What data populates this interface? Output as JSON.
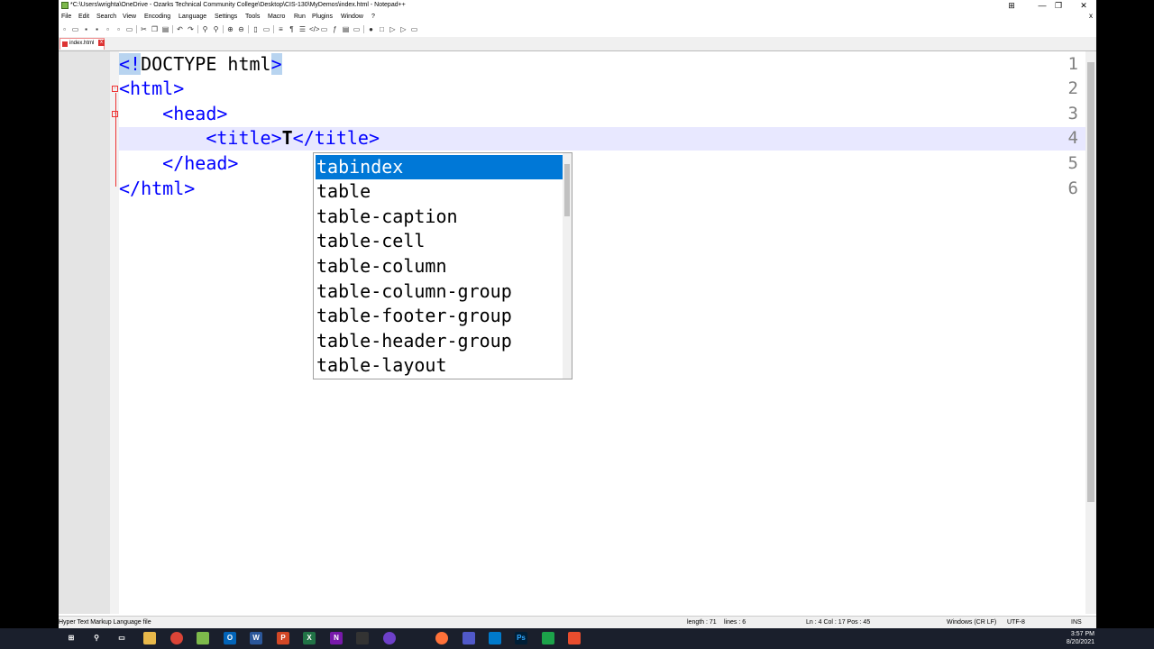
{
  "window": {
    "title": "*C:\\Users\\wrighta\\OneDrive - Ozarks Technical Community College\\Desktop\\CIS-130\\MyDemos\\index.html - Notepad++",
    "controls": {
      "tile": "⊞",
      "minimize": "—",
      "restore": "❐",
      "close": "✕"
    },
    "close_x2": "x"
  },
  "menu": [
    "File",
    "Edit",
    "Search",
    "View",
    "Encoding",
    "Language",
    "Settings",
    "Tools",
    "Macro",
    "Run",
    "Plugins",
    "Window",
    "?"
  ],
  "tab": {
    "label": "index.html",
    "close": "x"
  },
  "editor": {
    "line_numbers": [
      "1",
      "2",
      "3",
      "4",
      "5",
      "6"
    ],
    "lines": {
      "l1_open": "<!",
      "l1_doctype": "DOCTYPE html",
      "l1_close": ">",
      "l2": "<html>",
      "l3": "    <head>",
      "l4_indent": "        ",
      "l4_open": "<title>",
      "l4_typed": "T",
      "l4_close": "</title>",
      "l5": "    </head>",
      "l6": "</html>"
    }
  },
  "autocomplete": {
    "items": [
      "tabindex",
      "table",
      "table-caption",
      "table-cell",
      "table-column",
      "table-column-group",
      "table-footer-group",
      "table-header-group",
      "table-layout"
    ],
    "selected_index": 0
  },
  "status": {
    "file_type": "Hyper Text Markup Language file",
    "length": "length : 71",
    "lines": "lines : 6",
    "position": "Ln : 4    Col : 17    Pos : 45",
    "eol": "Windows (CR LF)",
    "encoding": "UTF-8",
    "mode": "INS"
  },
  "taskbar": {
    "time": "3:57 PM",
    "date": "8/20/2021",
    "apps": [
      "start-icon",
      "search-icon",
      "task-view-icon",
      "file-explorer-icon",
      "chrome-icon",
      "notepadpp-icon",
      "outlook-icon",
      "word-icon",
      "powerpoint-icon",
      "excel-icon",
      "onenote-icon",
      "github-icon",
      "firefox-icon",
      "teams-icon",
      "vscode-icon",
      "photoshop-icon",
      "camtasia-icon",
      "camtasia-recorder-icon"
    ]
  },
  "colors": {
    "accent": "#0078d7",
    "tag": "#0000ff",
    "current_line": "#e8e8ff",
    "selection": "#b8d4f0"
  }
}
